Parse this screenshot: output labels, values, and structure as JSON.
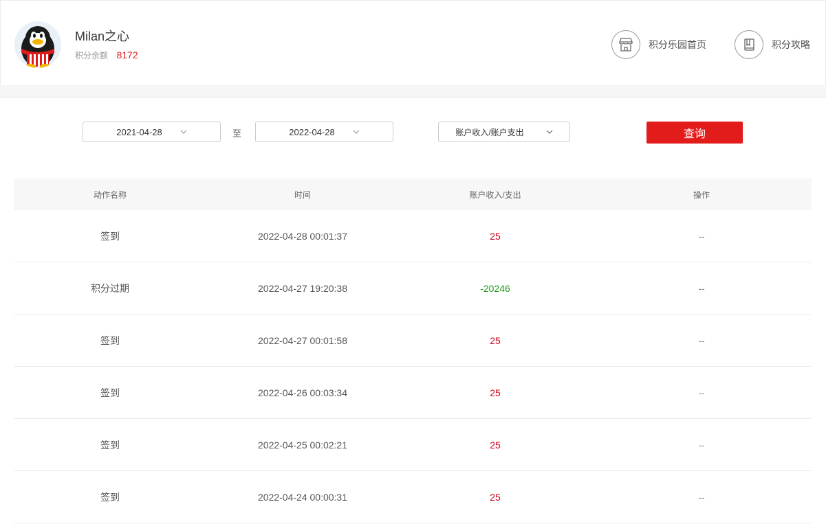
{
  "user": {
    "name": "Milan之心",
    "balance_label": "积分余额",
    "balance_value": "8172",
    "avatar_icon": "qq-penguin-avatar"
  },
  "nav": {
    "home": {
      "label": "积分乐园首页",
      "icon": "store-icon"
    },
    "guide": {
      "label": "积分攻略",
      "icon": "book-icon"
    }
  },
  "filter": {
    "start_date": "2021-04-28",
    "to_label": "至",
    "end_date": "2022-04-28",
    "type": "账户收入/账户支出",
    "query_label": "查询"
  },
  "table": {
    "headers": [
      "动作名称",
      "时间",
      "账户收入/支出",
      "操作"
    ],
    "rows": [
      {
        "action": "签到",
        "time": "2022-04-28 00:01:37",
        "amount": "25",
        "op": "--"
      },
      {
        "action": "积分过期",
        "time": "2022-04-27 19:20:38",
        "amount": "-20246",
        "op": "--"
      },
      {
        "action": "签到",
        "time": "2022-04-27 00:01:58",
        "amount": "25",
        "op": "--"
      },
      {
        "action": "签到",
        "time": "2022-04-26 00:03:34",
        "amount": "25",
        "op": "--"
      },
      {
        "action": "签到",
        "time": "2022-04-25 00:02:21",
        "amount": "25",
        "op": "--"
      },
      {
        "action": "签到",
        "time": "2022-04-24 00:00:31",
        "amount": "25",
        "op": "--"
      }
    ]
  },
  "colors": {
    "accent": "#e21b1b",
    "income": "#d0021b",
    "expense": "#1a9a1a"
  }
}
